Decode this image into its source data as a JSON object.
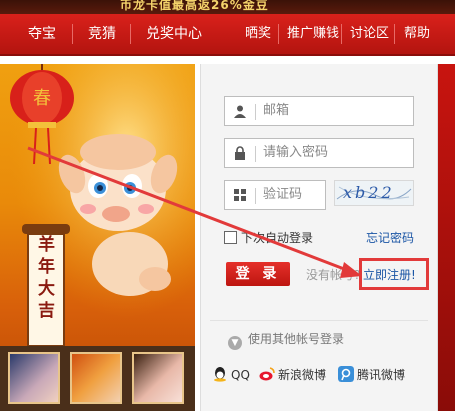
{
  "top_banner": {
    "text": "币龙卡值最高返26%金豆"
  },
  "nav": {
    "items": [
      "夺宝",
      "竞猜",
      "兑奖中心",
      "晒奖",
      "推广赚钱",
      "讨论区",
      "帮助"
    ]
  },
  "banner": {
    "scroll_text": "羊年大吉",
    "lantern_text": "春"
  },
  "login": {
    "email_placeholder": "邮箱",
    "password_placeholder": "请输入密码",
    "captcha_placeholder": "验证码",
    "captcha_text": "xb22",
    "remember_label": "下次自动登录",
    "forgot_label": "忘记密码",
    "login_button": "登 录",
    "no_account_text": "没有帐号?",
    "register_link": "立即注册!",
    "other_login_label": "使用其他帐号登录",
    "social": [
      "QQ",
      "新浪微博",
      "腾讯微博"
    ]
  },
  "colors": {
    "nav_red": "#c8180f",
    "annotation_red": "#e23a3a",
    "link_blue": "#1a55a5"
  }
}
